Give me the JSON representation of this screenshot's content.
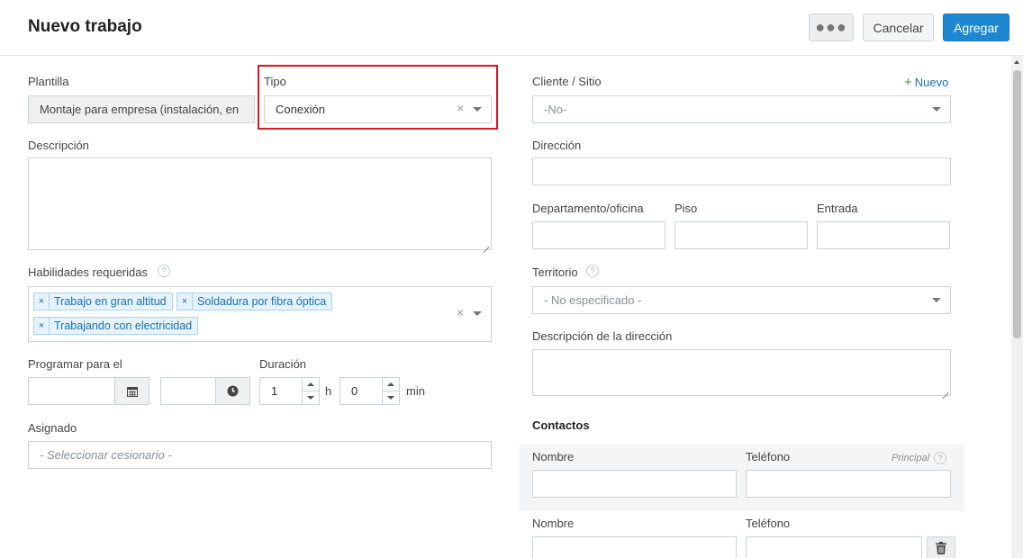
{
  "header": {
    "title": "Nuevo trabajo",
    "more_label": "●●●",
    "cancel_label": "Cancelar",
    "add_label": "Agregar"
  },
  "left": {
    "template_label": "Plantilla",
    "template_value": "Montaje para empresa (instalación, en",
    "type_label": "Tipo",
    "type_value": "Conexión",
    "description_label": "Descripción",
    "skills_label": "Habilidades requeridas",
    "skills": [
      "Trabajo en gran altitud",
      "Soldadura por fibra óptica",
      "Trabajando con electricidad"
    ],
    "schedule_label": "Programar para el",
    "duration_label": "Duración",
    "duration_hours": "1",
    "hours_unit": "h",
    "duration_minutes": "0",
    "minutes_unit": "min",
    "assigned_label": "Asignado",
    "assigned_placeholder": "- Seleccionar cesionario -"
  },
  "right": {
    "client_label": "Cliente / Sitio",
    "new_label": "Nuevo",
    "client_placeholder": "-No-",
    "address_label": "Dirección",
    "apartment_label": "Departamento/oficina",
    "floor_label": "Piso",
    "entrance_label": "Entrada",
    "territory_label": "Territorio",
    "territory_placeholder": "- No especificado -",
    "address_desc_label": "Descripción de la dirección",
    "contacts_title": "Contactos",
    "contacts": [
      {
        "name_label": "Nombre",
        "phone_label": "Teléfono",
        "principal_label": "Principal"
      },
      {
        "name_label": "Nombre",
        "phone_label": "Teléfono"
      }
    ]
  },
  "colors": {
    "accent": "#1d87d1",
    "highlight": "#e0141e",
    "tag_bg": "#e7f3fb",
    "add_green": "#3aa54a"
  },
  "icons": {
    "calendar": "calendar-icon",
    "clock": "clock-icon",
    "trash": "trash-icon",
    "help": "help-icon"
  }
}
